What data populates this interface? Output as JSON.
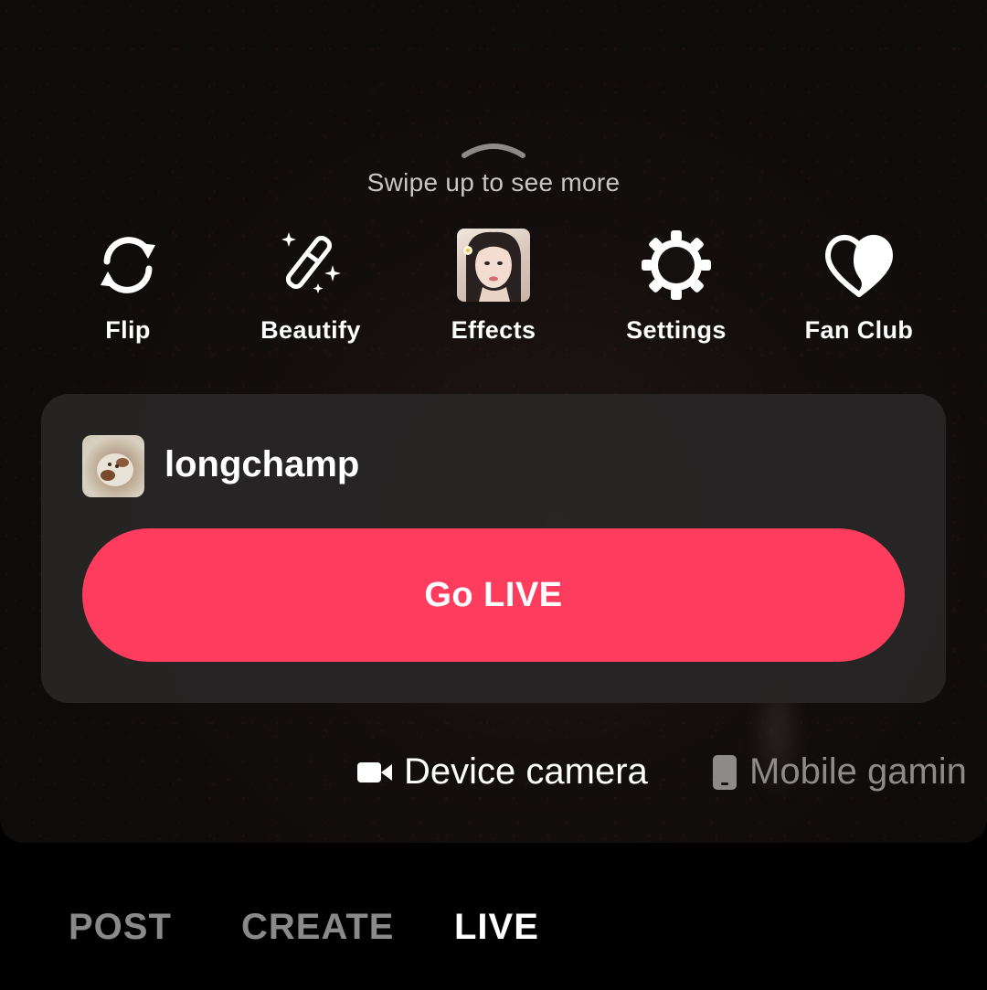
{
  "hint": {
    "swipe_text": "Swipe up to see more"
  },
  "tools": [
    {
      "label": "Flip",
      "icon": "flip-camera-icon"
    },
    {
      "label": "Beautify",
      "icon": "magic-wand-icon"
    },
    {
      "label": "Effects",
      "icon": "effects-thumbnail"
    },
    {
      "label": "Settings",
      "icon": "gear-icon"
    },
    {
      "label": "Fan Club",
      "icon": "heart-icon"
    }
  ],
  "account": {
    "username": "longchamp"
  },
  "primary_action": {
    "label": "Go LIVE",
    "color": "#fd3c5e"
  },
  "sources": [
    {
      "label": "Device camera",
      "icon": "video-camera-icon",
      "selected": true
    },
    {
      "label": "Mobile gamin",
      "icon": "phone-icon",
      "selected": false
    }
  ],
  "modes": [
    {
      "label": "POST",
      "selected": false
    },
    {
      "label": "CREATE",
      "selected": false
    },
    {
      "label": "LIVE",
      "selected": true
    }
  ]
}
